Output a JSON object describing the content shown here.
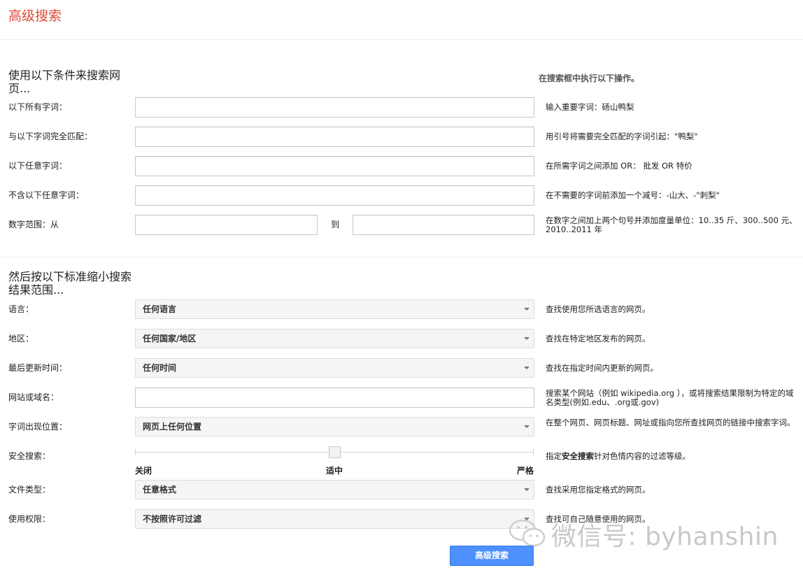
{
  "page": {
    "title": "高级搜索"
  },
  "section1": {
    "heading": "使用以下条件来搜索网页...",
    "hint_heading": "在搜索框中执行以下操作。",
    "rows": [
      {
        "label": "以下所有字词：",
        "value": "",
        "hint": "输入重要字词：砀山鸭梨"
      },
      {
        "label": "与以下字词完全匹配：",
        "value": "",
        "hint": "用引号将需要完全匹配的字词引起：\"鸭梨\""
      },
      {
        "label": "以下任意字词：",
        "value": "",
        "hint": "在所需字词之间添加 OR： 批发 OR 特价"
      },
      {
        "label": "不含以下任意字词：",
        "value": "",
        "hint": "在不需要的字词前添加一个减号：-山大、-\"刺梨\""
      }
    ],
    "range": {
      "label": "数字范围：从",
      "from_value": "",
      "to_label": "到",
      "to_value": "",
      "hint": "在数字之间加上两个句号并添加度量单位：10..35 斤、300..500 元、2010..2011 年"
    }
  },
  "section2": {
    "heading": "然后按以下标准缩小搜索结果范围...",
    "language": {
      "label": "语言：",
      "selected": "任何语言",
      "hint": "查找使用您所选语言的网页。"
    },
    "region": {
      "label": "地区：",
      "selected": "任何国家/地区",
      "hint": "查找在特定地区发布的网页。"
    },
    "last_update": {
      "label": "最后更新时间：",
      "selected": "任何时间",
      "hint": "查找在指定时间内更新的网页。"
    },
    "site": {
      "label": "网站或域名：",
      "value": "",
      "hint": "搜索某个网站（例如 wikipedia.org ），或将搜索结果限制为特定的域名类型(例如.edu、.org或.gov)"
    },
    "terms_position": {
      "label": "字词出现位置：",
      "selected": "网页上任何位置",
      "hint": "在整个网页、网页标题、网址或指向您所查找网页的链接中搜索字词。"
    },
    "safe_search": {
      "label": "安全搜索：",
      "level": 0.5,
      "stops": [
        "关闭",
        "适中",
        "严格"
      ],
      "hint_pre": "指定",
      "hint_link": "安全搜索",
      "hint_post": "针对色情内容的过滤等级。"
    },
    "file_type": {
      "label": "文件类型：",
      "selected": "任意格式",
      "hint": "查找采用您指定格式的网页。"
    },
    "usage_rights": {
      "label": "使用权限：",
      "selected": "不按照许可过滤",
      "hint": "查找可自己随意使用的网页。"
    }
  },
  "submit": {
    "label": "高级搜索"
  },
  "watermark": {
    "text": "微信号: byhanshin"
  },
  "colors": {
    "title": "#dd4b39",
    "button": "#4d90fe"
  }
}
